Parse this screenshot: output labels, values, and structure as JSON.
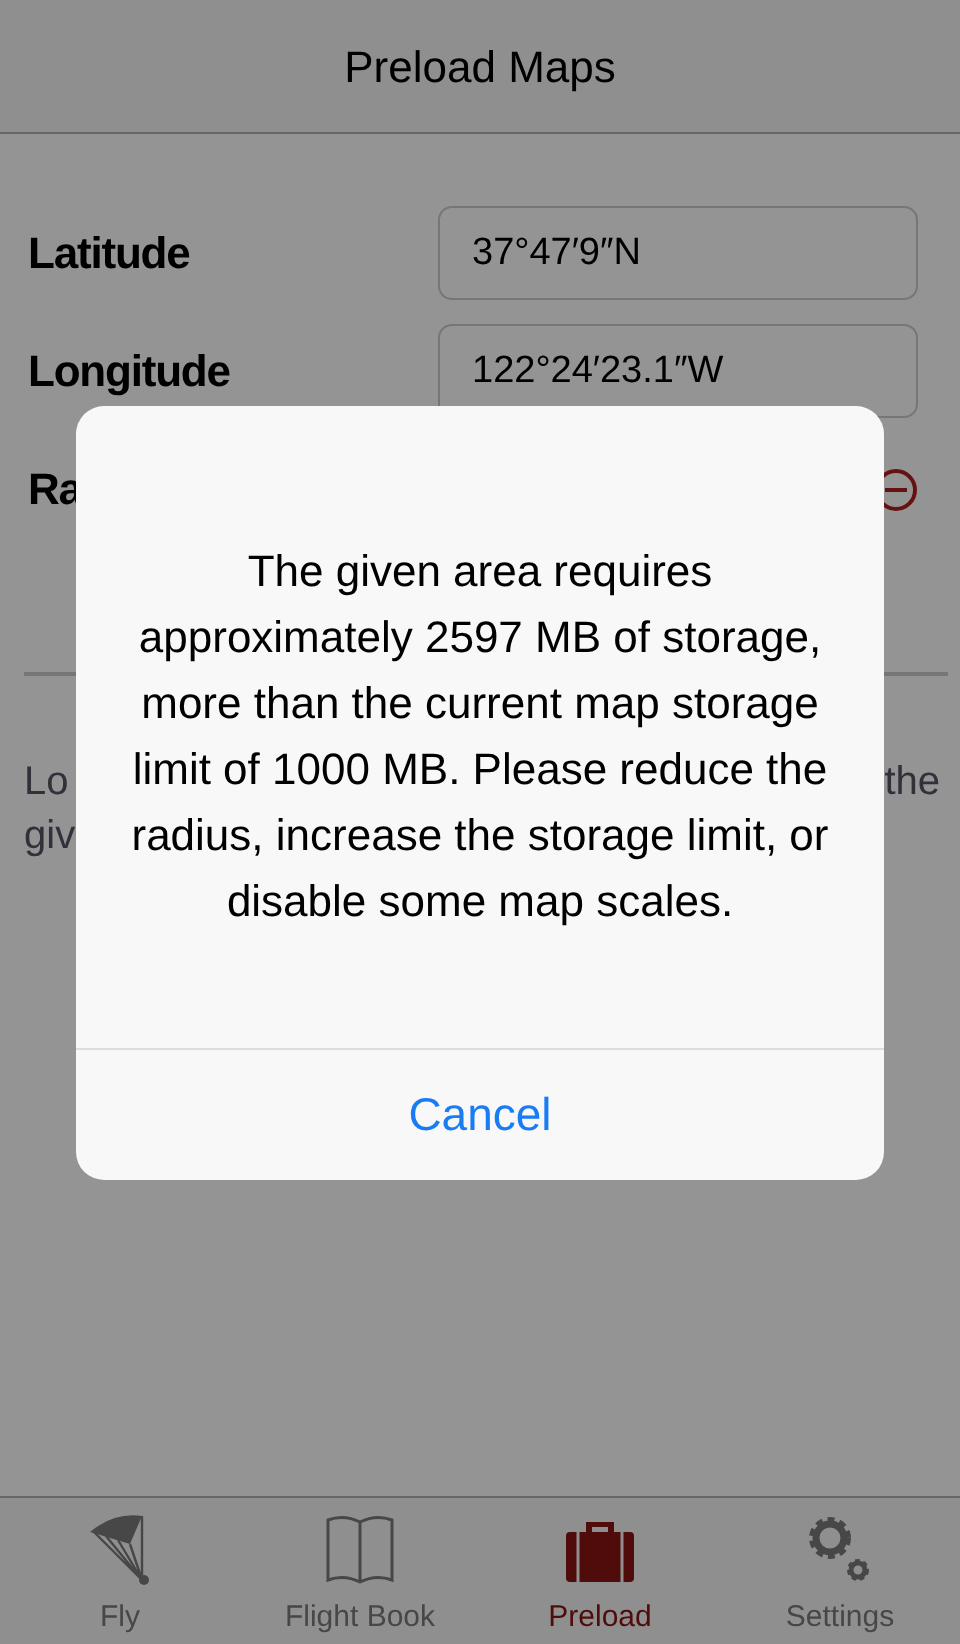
{
  "nav_bar": {
    "title": "Preload Maps"
  },
  "form": {
    "fields": [
      {
        "label": "Latitude",
        "value": "37°47′9″N"
      },
      {
        "label": "Longitude",
        "value": "122°24′23.1″W"
      }
    ],
    "radius_row": {
      "label": "Ra"
    }
  },
  "description": {
    "line_1_start": "Lo",
    "line_1_end": "the",
    "line_2_start": "giv"
  },
  "alert": {
    "message": "The given area requires approximately 2597 MB of storage, more than the current map storage limit of 1000 MB. Please reduce the radius, increase the storage limit, or disable some map scales.",
    "buttons": [
      "Cancel"
    ]
  },
  "tab_bar": {
    "tabs": [
      {
        "label": "Fly",
        "kind": "paraglider",
        "selected": false
      },
      {
        "label": "Flight Book",
        "kind": "book",
        "selected": false
      },
      {
        "label": "Preload",
        "kind": "suitcase",
        "selected": true
      },
      {
        "label": "Settings",
        "kind": "gears",
        "selected": false
      }
    ]
  }
}
